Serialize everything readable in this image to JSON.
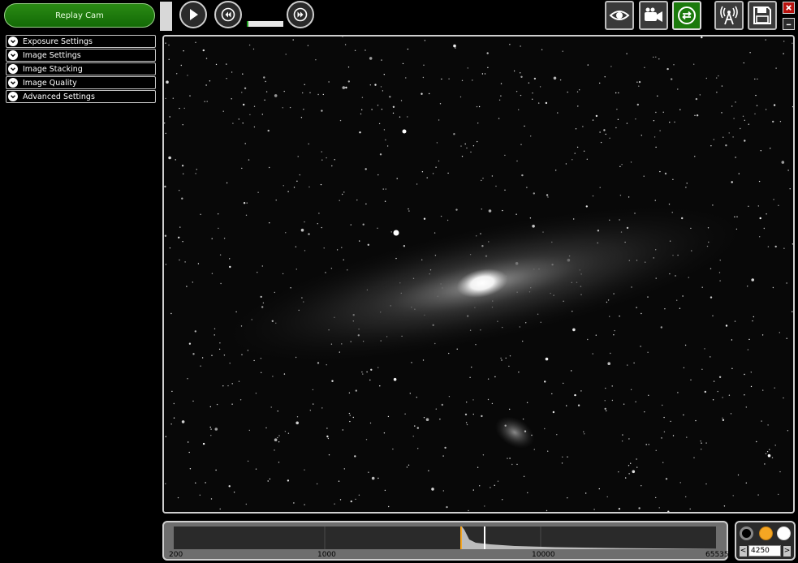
{
  "left_panel": {
    "replay_button": "Replay Cam",
    "settings": [
      {
        "label": "Exposure Settings"
      },
      {
        "label": "Image Settings"
      },
      {
        "label": "Image Stacking"
      },
      {
        "label": "Image Quality"
      },
      {
        "label": "Advanced Settings"
      }
    ]
  },
  "playback": {
    "play_icon": "play-icon",
    "rewind_icon": "rewind-icon",
    "fast_forward_icon": "fast-forward-icon",
    "speed_level": 0.05
  },
  "toolbar": {
    "icons": [
      "eye-icon",
      "video-camera-icon",
      "repeat-icon",
      "broadcast-icon",
      "save-icon"
    ],
    "active_icon": "repeat-icon",
    "close_icon": "close-icon",
    "minimize_icon": "minimize-icon"
  },
  "histogram": {
    "tick_labels": [
      "200",
      "1000",
      "10000",
      "65535"
    ],
    "black_point": 4250
  },
  "stretch": {
    "value": "4250",
    "left_arrow": "<",
    "right_arrow": ">",
    "dots": [
      "black",
      "orange",
      "white"
    ]
  },
  "colors": {
    "accent_green": "#1b7a0c",
    "orange": "#f5a623",
    "close_red": "#b8120e"
  }
}
